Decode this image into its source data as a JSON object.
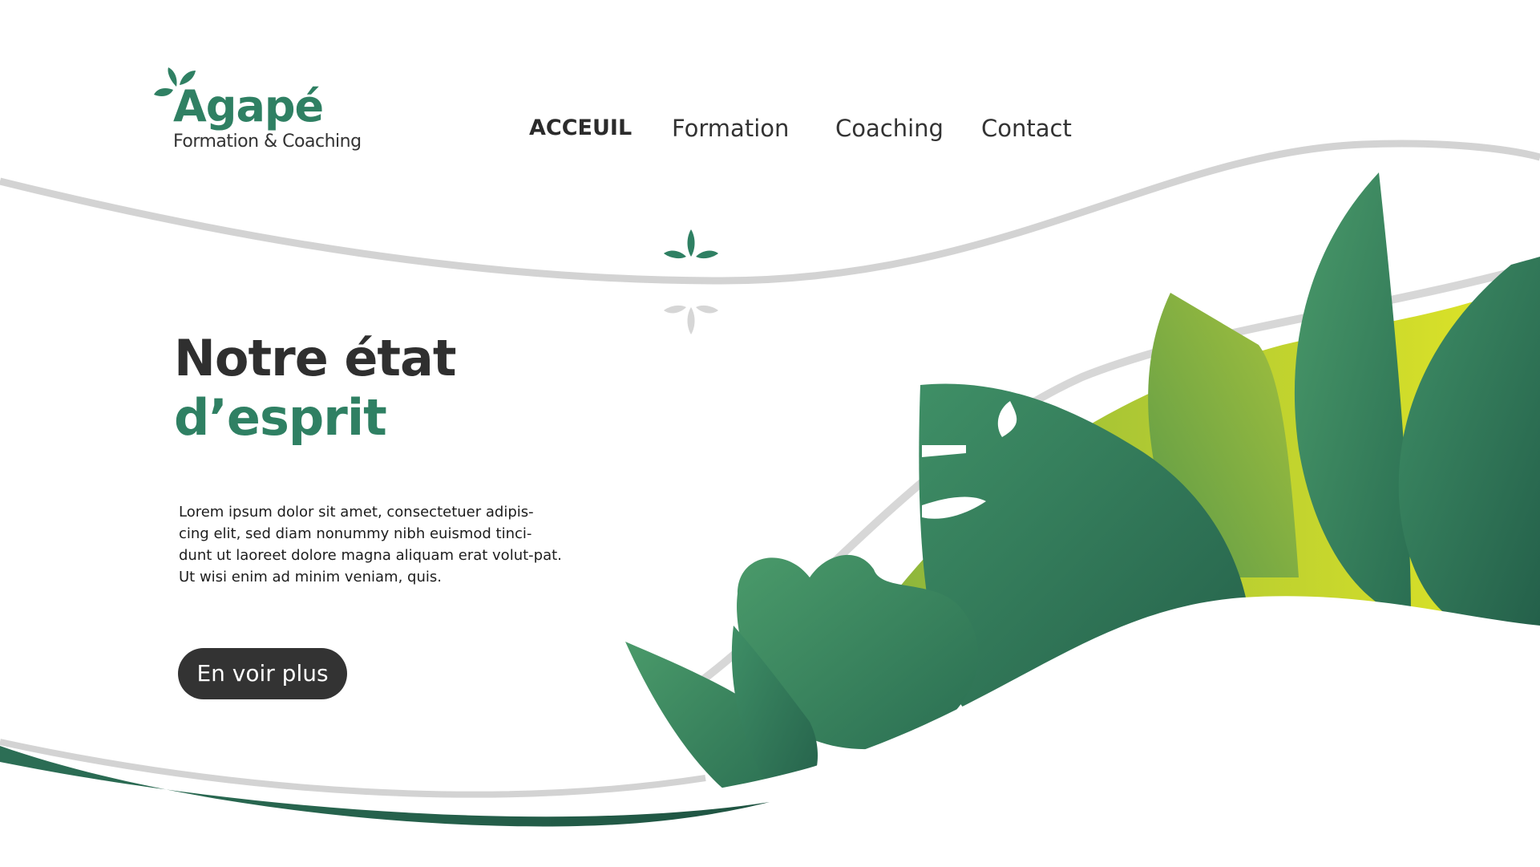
{
  "brand": {
    "name": "Agapé",
    "tagline": "Formation & Coaching",
    "primary_color": "#2f8063",
    "dark_color": "#333333",
    "accent_color": "#d9e02c"
  },
  "nav": {
    "items": [
      {
        "label": "ACCEUIL",
        "active": true
      },
      {
        "label": "Formation",
        "active": false
      },
      {
        "label": "Coaching",
        "active": false
      },
      {
        "label": "Contact",
        "active": false
      }
    ]
  },
  "hero": {
    "title_line1": "Notre état",
    "title_line2": "d’esprit",
    "body": "Lorem ipsum dolor sit amet, consectetuer adipis-cing elit, sed diam nonummy nibh euismod tinci-dunt ut laoreet dolore magna aliquam erat volut-pat. Ut wisi enim ad minim veniam, quis.",
    "button_label": "En voir plus"
  },
  "icons": {
    "logo": "leaf-sprout-icon",
    "divider_top": "sprout-icon",
    "divider_bottom": "sprout-icon"
  }
}
